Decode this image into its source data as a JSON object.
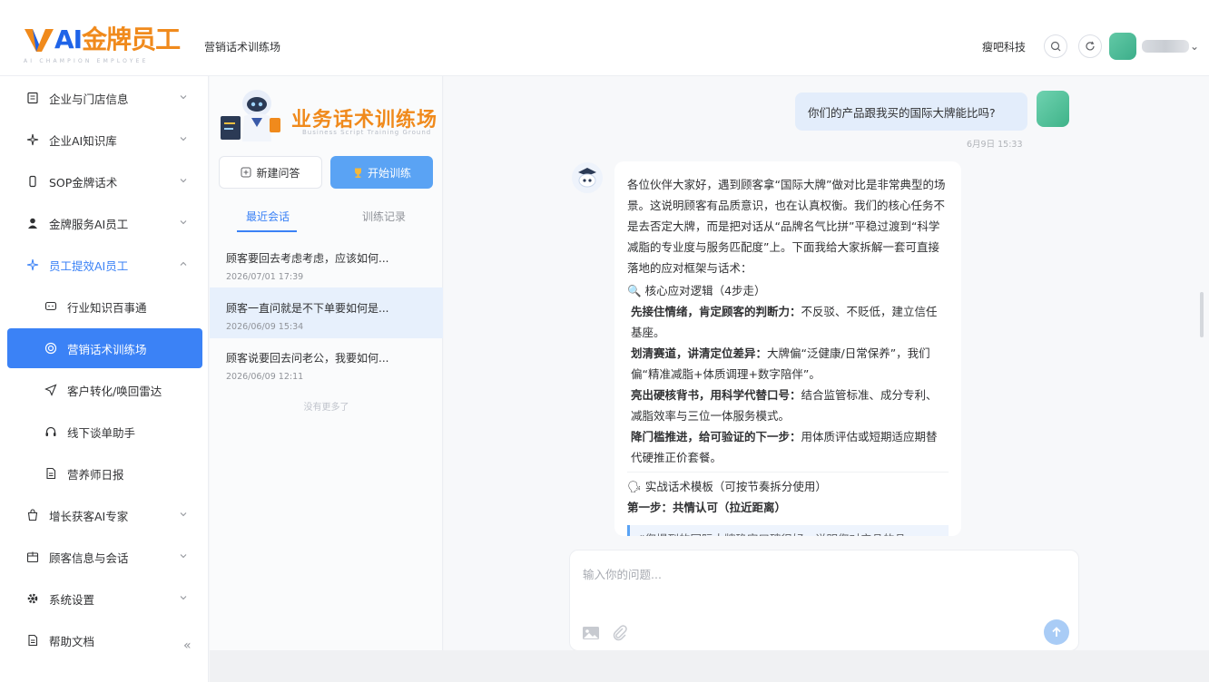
{
  "header": {
    "logo_text_ai": "AI",
    "logo_text_cn": "金牌员工",
    "logo_sub": "AI CHAMPION EMPLOYEE",
    "breadcrumb": "营销话术训练场",
    "company": "瘦吧科技"
  },
  "sidebar": {
    "items": [
      {
        "label": "企业与门店信息"
      },
      {
        "label": "企业AI知识库"
      },
      {
        "label": "SOP金牌话术"
      },
      {
        "label": "金牌服务AI员工"
      },
      {
        "label": "员工提效AI员工"
      },
      {
        "label": "行业知识百事通"
      },
      {
        "label": "营销话术训练场"
      },
      {
        "label": "客户转化/唤回雷达"
      },
      {
        "label": "线下谈单助手"
      },
      {
        "label": "营养师日报"
      },
      {
        "label": "增长获客AI专家"
      },
      {
        "label": "顾客信息与会话"
      },
      {
        "label": "系统设置"
      },
      {
        "label": "帮助文档"
      }
    ],
    "collapse_glyph": "«"
  },
  "history": {
    "banner_title": "业务话术训练场",
    "banner_en": "Business Script Training Ground",
    "new_button": "新建问答",
    "start_button": "开始训练",
    "tabs": [
      "最近会话",
      "训练记录"
    ],
    "conversations": [
      {
        "title": "顾客要回去考虑考虑，应该如何...",
        "date": "2026/07/01 17:39"
      },
      {
        "title": "顾客一直问就是不下单要如何是...",
        "date": "2026/06/09 15:34"
      },
      {
        "title": "顾客说要回去问老公，我要如何...",
        "date": "2026/06/09 12:11"
      }
    ],
    "no_more": "没有更多了"
  },
  "chat": {
    "user_message": "你们的产品跟我买的国际大牌能比吗?",
    "user_time": "6月9日 15:33",
    "bot": {
      "intro": "各位伙伴大家好，遇到顾客拿“国际大牌”做对比是非常典型的场景。这说明顾客有品质意识，也在认真权衡。我们的核心任务不是去否定大牌，而是把对话从“品牌名气比拼”平稳过渡到“科学减脂的专业度与服务匹配度”上。下面我给大家拆解一套可直接落地的应对框架与话术：",
      "logic_heading": "核心应对逻辑（4步走）",
      "points": [
        {
          "bold": "先接住情绪，肯定顾客的判断力：",
          "text": "不反驳、不贬低，建立信任基座。"
        },
        {
          "bold": "划清赛道，讲清定位差异：",
          "text": "大牌偏“泛健康/日常保养”，我们偏“精准减脂+体质调理+数字陪伴”。"
        },
        {
          "bold": "亮出硬核背书，用科学代替口号：",
          "text": "结合监管标准、成分专利、减脂效率与三位一体服务模式。"
        },
        {
          "bold": "降门槛推进，给可验证的下一步：",
          "text": "用体质评估或短期适应期替代硬推正价套餐。"
        }
      ],
      "template_heading": "实战话术模板（可按节奏拆分使用）",
      "step1": "第一步：共情认可（拉近距离）",
      "quote": "“您提到的国际大牌确实口碑很好，说明您对产品的品"
    },
    "input_placeholder": "输入你的问题..."
  },
  "colors": {
    "accent": "#3b82f6",
    "logo_orange": "#f08a1c",
    "active_bg": "#3b82f6",
    "user_bubble": "#e3edfb"
  }
}
